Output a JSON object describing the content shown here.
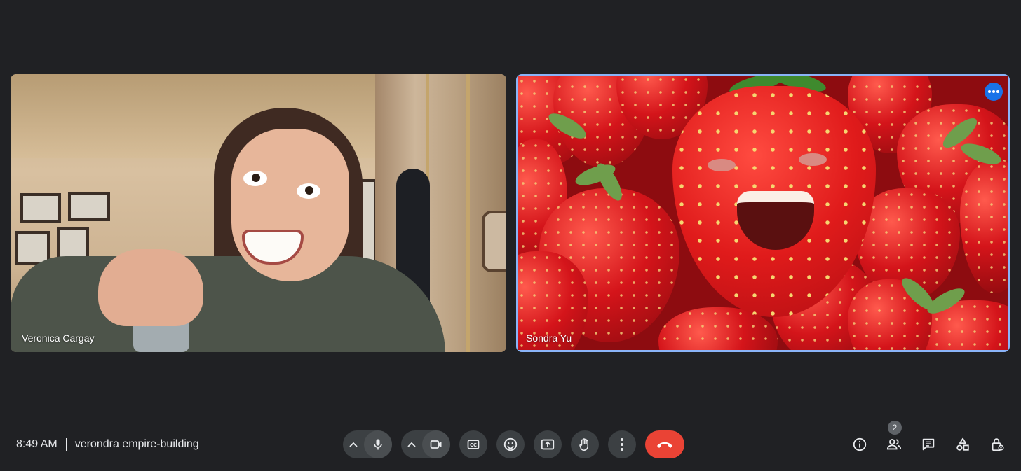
{
  "participants": [
    {
      "name": "Veronica Cargay"
    },
    {
      "name": "Sondra Yu"
    }
  ],
  "meeting": {
    "time": "8:49 AM",
    "title": "verondra empire-building"
  },
  "people_count": "2",
  "colors": {
    "background": "#202124",
    "control_bg": "#3c4043",
    "end_call": "#ea4335",
    "active_speaker_outline": "#8ab4f8",
    "tile_menu": "#1a73e8"
  },
  "icons": {
    "controls": [
      "chevron-up-icon",
      "microphone-icon",
      "chevron-up-icon",
      "camera-icon",
      "captions-icon",
      "emoji-icon",
      "present-icon",
      "raise-hand-icon",
      "more-options-icon",
      "end-call-icon"
    ],
    "right_tools": [
      "info-icon",
      "people-icon",
      "chat-icon",
      "activities-icon",
      "host-controls-icon"
    ]
  }
}
